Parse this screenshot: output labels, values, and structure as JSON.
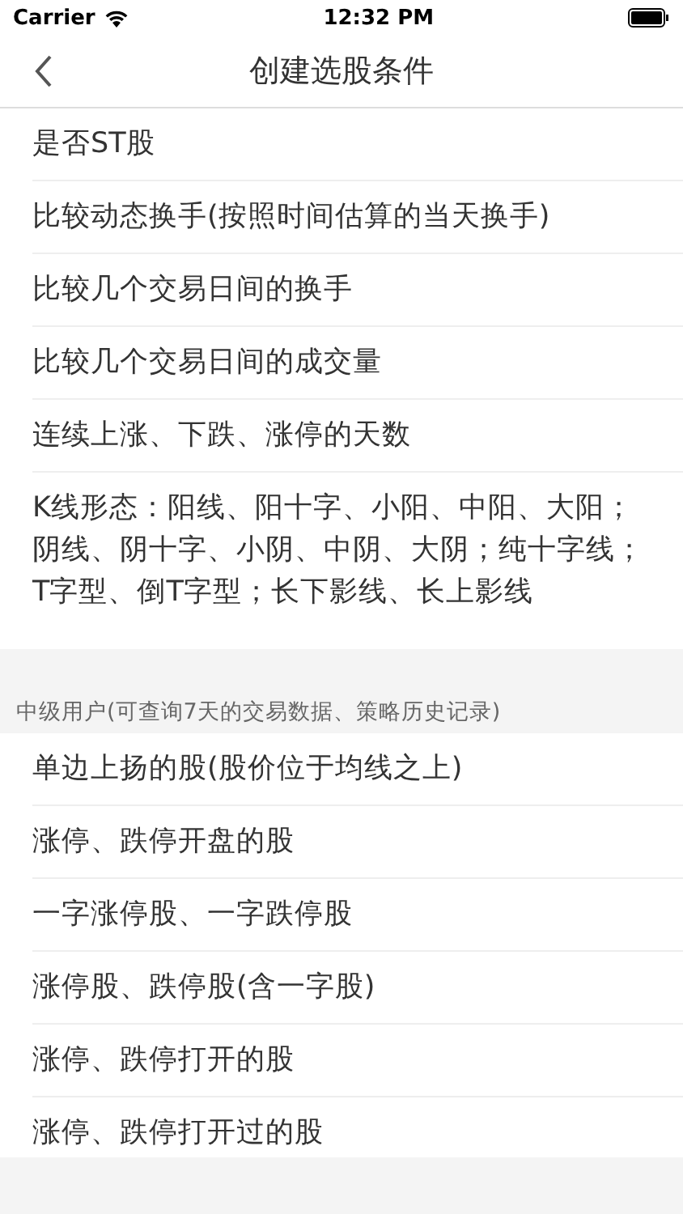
{
  "status_bar": {
    "carrier": "Carrier",
    "time": "12:32 PM"
  },
  "nav": {
    "title": "创建选股条件"
  },
  "sections": [
    {
      "items": [
        {
          "label": "是否ST股"
        },
        {
          "label": "比较动态换手(按照时间估算的当天换手)"
        },
        {
          "label": "比较几个交易日间的换手"
        },
        {
          "label": "比较几个交易日间的成交量"
        },
        {
          "label": "连续上涨、下跌、涨停的天数"
        },
        {
          "label": "K线形态：阳线、阳十字、小阳、中阳、大阳；阴线、阴十字、小阴、中阴、大阴；纯十字线；T字型、倒T字型；长下影线、长上影线"
        }
      ]
    },
    {
      "header": "中级用户(可查询7天的交易数据、策略历史记录)",
      "items": [
        {
          "label": "单边上扬的股(股价位于均线之上)"
        },
        {
          "label": "涨停、跌停开盘的股"
        },
        {
          "label": "一字涨停股、一字跌停股"
        },
        {
          "label": "涨停股、跌停股(含一字股)"
        },
        {
          "label": "涨停、跌停打开的股"
        },
        {
          "label": "涨停、跌停打开过的股"
        }
      ]
    }
  ]
}
